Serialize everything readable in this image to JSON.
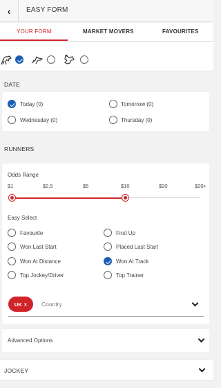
{
  "header": {
    "back_icon": "chevron-left-icon",
    "title": "EASY FORM"
  },
  "tabs": [
    {
      "label": "YOUR FORM",
      "active": true
    },
    {
      "label": "MARKET MOVERS",
      "active": false
    },
    {
      "label": "FAVOURITES",
      "active": false
    }
  ],
  "race_types": [
    {
      "icon": "horse-icon",
      "checked": true
    },
    {
      "icon": "harness-icon",
      "checked": false
    },
    {
      "icon": "greyhound-icon",
      "checked": false
    }
  ],
  "date": {
    "label": "DATE",
    "options": [
      {
        "label": "Today (0)",
        "checked": true
      },
      {
        "label": "Tomorrow (0)",
        "checked": false
      },
      {
        "label": "Wednesday (0)",
        "checked": false
      },
      {
        "label": "Thursday (0)",
        "checked": false
      }
    ]
  },
  "runners": {
    "label": "RUNNERS",
    "odds_range": {
      "label": "Odds Range",
      "ticks": [
        "$1",
        "$2.5",
        "$5",
        "$10",
        "$20",
        "$20+"
      ],
      "min": "$1",
      "max": "$10"
    },
    "easy_select": {
      "label": "Easy Select",
      "options": [
        {
          "label": "Favourite",
          "checked": false
        },
        {
          "label": "First Up",
          "checked": false
        },
        {
          "label": "Won Last Start",
          "checked": false
        },
        {
          "label": "Placed Last Start",
          "checked": false
        },
        {
          "label": "Won At Distance",
          "checked": false
        },
        {
          "label": "Won At Track",
          "checked": true
        },
        {
          "label": "Top Jockey/Driver",
          "checked": false
        },
        {
          "label": "Top Trainer",
          "checked": false
        }
      ]
    },
    "country": {
      "chip": "UK",
      "chip_close": "×",
      "placeholder": "Country"
    }
  },
  "advanced": {
    "label": "Advanced Options"
  },
  "jockey": {
    "label": "JOCKEY"
  },
  "colors": {
    "accent": "#d0232a",
    "checked": "#1a5fb4"
  }
}
